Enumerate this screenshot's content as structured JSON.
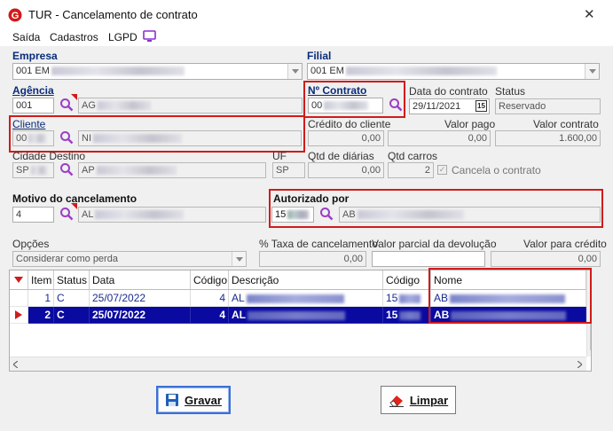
{
  "window": {
    "title": "TUR - Cancelamento de contrato",
    "close_glyph": "✕"
  },
  "menu": {
    "items": [
      "Saída",
      "Cadastros",
      "LGPD"
    ],
    "lgpd_icon": "monitor-icon"
  },
  "empresa": {
    "label": "Empresa",
    "value": "001 EM"
  },
  "filial": {
    "label": "Filial",
    "value": "001 EM"
  },
  "agencia": {
    "label": "Agência",
    "code": "001",
    "name": "AG"
  },
  "contrato": {
    "label": "Nº Contrato",
    "value": "00"
  },
  "data_contrato": {
    "label": "Data do contrato",
    "value": "29/11/2021",
    "calendar_icon": "15"
  },
  "status": {
    "label": "Status",
    "value": "Reservado"
  },
  "cliente": {
    "label": "Cliente",
    "code": "00",
    "name": "NI"
  },
  "credito": {
    "label": "Crédito do cliente",
    "value": "0,00"
  },
  "valor_pago": {
    "label": "Valor pago",
    "value": "0,00"
  },
  "valor_contrato": {
    "label": "Valor contrato",
    "value": "1.600,00"
  },
  "cidade": {
    "label": "Cidade Destino",
    "code": "SP",
    "name": "AP"
  },
  "uf": {
    "label": "UF",
    "value": "SP"
  },
  "diarias": {
    "label": "Qtd de diárias",
    "value": "0,00"
  },
  "carros": {
    "label": "Qtd carros",
    "value": "2"
  },
  "cancela": {
    "label": "Cancela o contrato",
    "checked": true
  },
  "motivo": {
    "label": "Motivo do cancelamento",
    "code": "4",
    "name": "AL"
  },
  "autorizado": {
    "label": "Autorizado por",
    "code": "15",
    "name": "AB"
  },
  "opcoes": {
    "label": "Opções",
    "value": "Considerar como perda"
  },
  "taxa": {
    "label": "% Taxa de cancelamento",
    "value": "0,00"
  },
  "parcial": {
    "label": "Valor parcial da devolução",
    "value": ""
  },
  "valor_credito": {
    "label": "Valor para crédito",
    "value": "0,00"
  },
  "grid": {
    "columns": [
      "Item",
      "Status",
      "Data",
      "Código",
      "Descrição",
      "Código",
      "Nome"
    ],
    "rows": [
      {
        "item": "1",
        "status": "C",
        "data": "25/07/2022",
        "codigo": "4",
        "descricao": "AL",
        "codigo2": "15",
        "nome": "AB"
      },
      {
        "item": "2",
        "status": "C",
        "data": "25/07/2022",
        "codigo": "4",
        "descricao": "AL",
        "codigo2": "15",
        "nome": "AB"
      }
    ]
  },
  "buttons": {
    "gravar": "Gravar",
    "limpar": "Limpar"
  },
  "colors": {
    "highlight": "#d11b1b",
    "selected_row": "#0a0aa0",
    "accent_magnifier": "#9b3fc4"
  }
}
